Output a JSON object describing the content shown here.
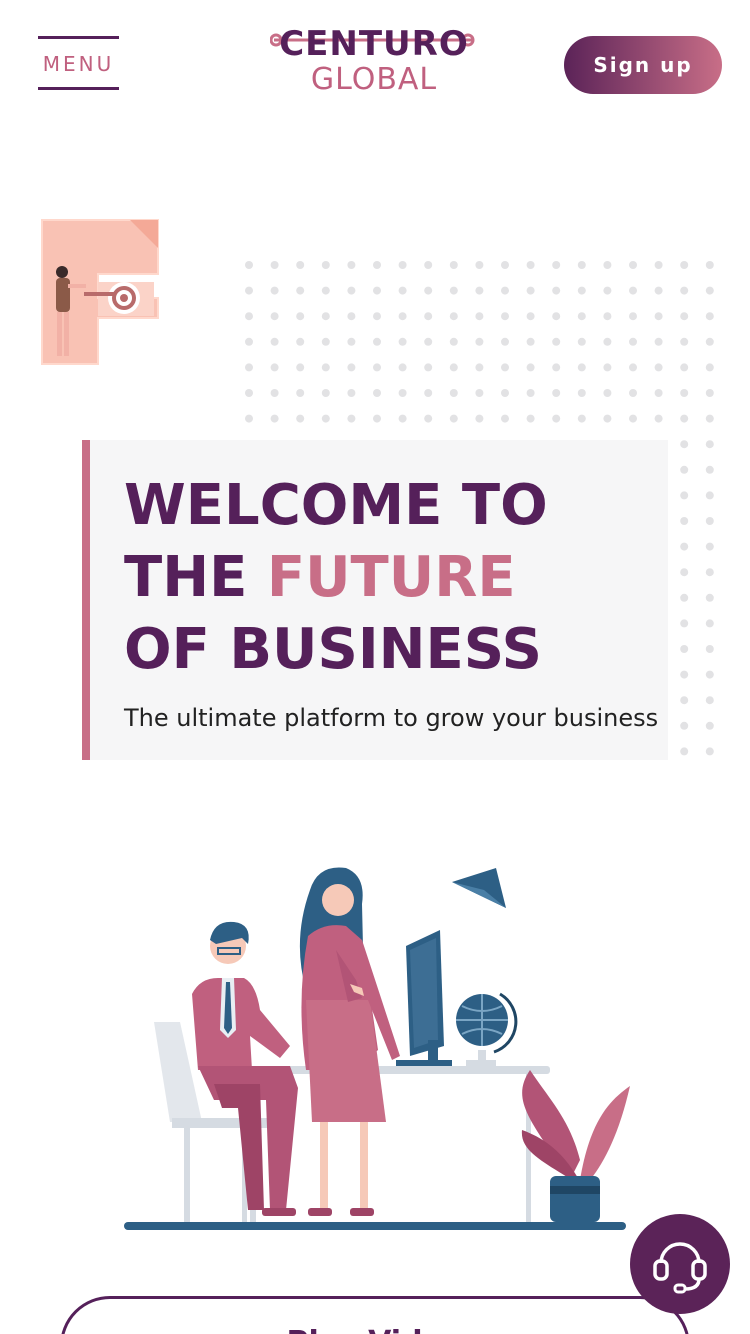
{
  "header": {
    "menu_label": "MENU",
    "logo_line1": "CENTURO",
    "logo_line2": "GLOBAL",
    "signup_label": "Sign up"
  },
  "hero": {
    "title_line1": "WELCOME TO",
    "title_line2_a": "THE ",
    "title_line2_b": "FUTURE",
    "title_line3": "OF BUSINESS",
    "subtitle": "The ultimate platform to grow your business"
  },
  "cta": {
    "play_video_label": "Play Video"
  },
  "icons": {
    "support": "headset-icon",
    "illustration_letter": "F"
  },
  "colors": {
    "primary": "#55205a",
    "accent": "#c86e87",
    "panel_bg": "#f6f6f7",
    "illustration_blue": "#2d5f85"
  }
}
